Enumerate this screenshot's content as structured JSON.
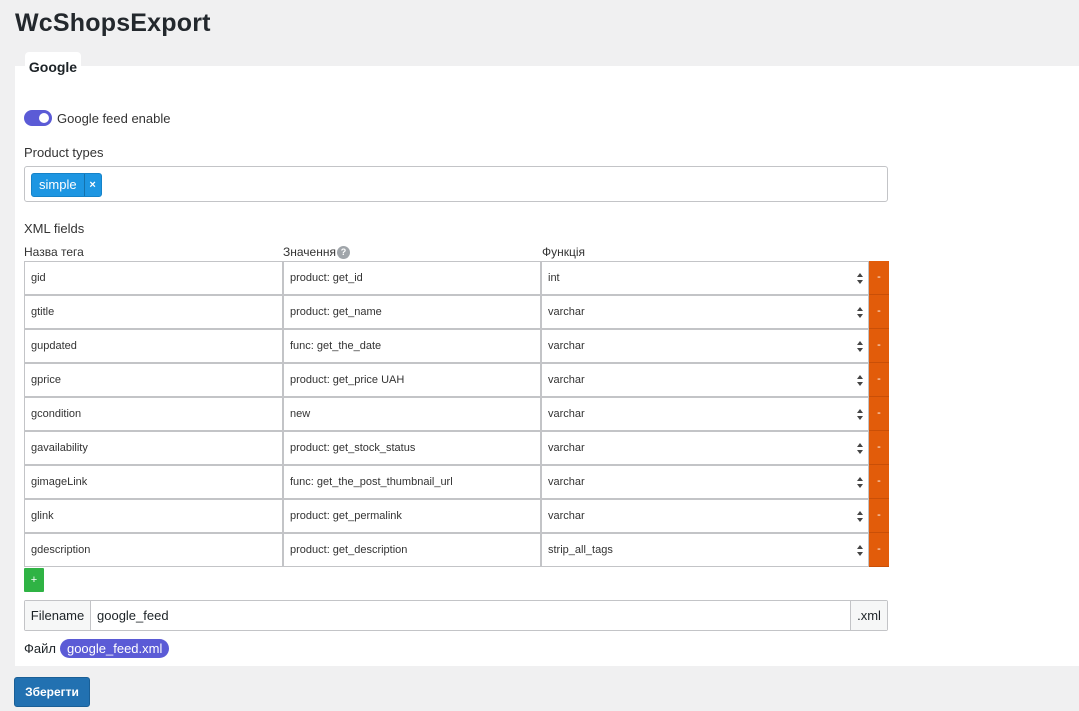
{
  "page_title": "WcShopsExport",
  "tab": {
    "label": "Google"
  },
  "toggle": {
    "label": "Google feed enable",
    "enabled": true
  },
  "product_types": {
    "label": "Product types",
    "selected": [
      {
        "label": "simple",
        "remove": "×"
      }
    ]
  },
  "xml_fields": {
    "label": "XML fields",
    "columns": [
      "Назва тега",
      "Значення",
      "Функція"
    ],
    "help_icon": "?",
    "rows": [
      {
        "tag": "gid",
        "value": "product: get_id",
        "func": "int"
      },
      {
        "tag": "gtitle",
        "value": "product: get_name",
        "func": "varchar"
      },
      {
        "tag": "gupdated",
        "value": "func: get_the_date",
        "func": "varchar"
      },
      {
        "tag": "gprice",
        "value": "product: get_price UAH",
        "func": "varchar"
      },
      {
        "tag": "gcondition",
        "value": "new",
        "func": "varchar"
      },
      {
        "tag": "gavailability",
        "value": "product: get_stock_status",
        "func": "varchar"
      },
      {
        "tag": "gimageLink",
        "value": "func: get_the_post_thumbnail_url",
        "func": "varchar"
      },
      {
        "tag": "glink",
        "value": "product: get_permalink",
        "func": "varchar"
      },
      {
        "tag": "gdescription",
        "value": "product: get_description",
        "func": "strip_all_tags"
      }
    ],
    "remove_label": "-",
    "add_label": "+"
  },
  "filename": {
    "prefix": "Filename",
    "value": "google_feed",
    "suffix": ".xml"
  },
  "file": {
    "label": "Файл",
    "link": "google_feed.xml"
  },
  "save_label": "Зберегти",
  "colors": {
    "accent": "#5b5bd6",
    "danger": "#e25c0a",
    "success": "#2fb344",
    "primary": "#2271b1",
    "chip": "#1d96e2"
  }
}
